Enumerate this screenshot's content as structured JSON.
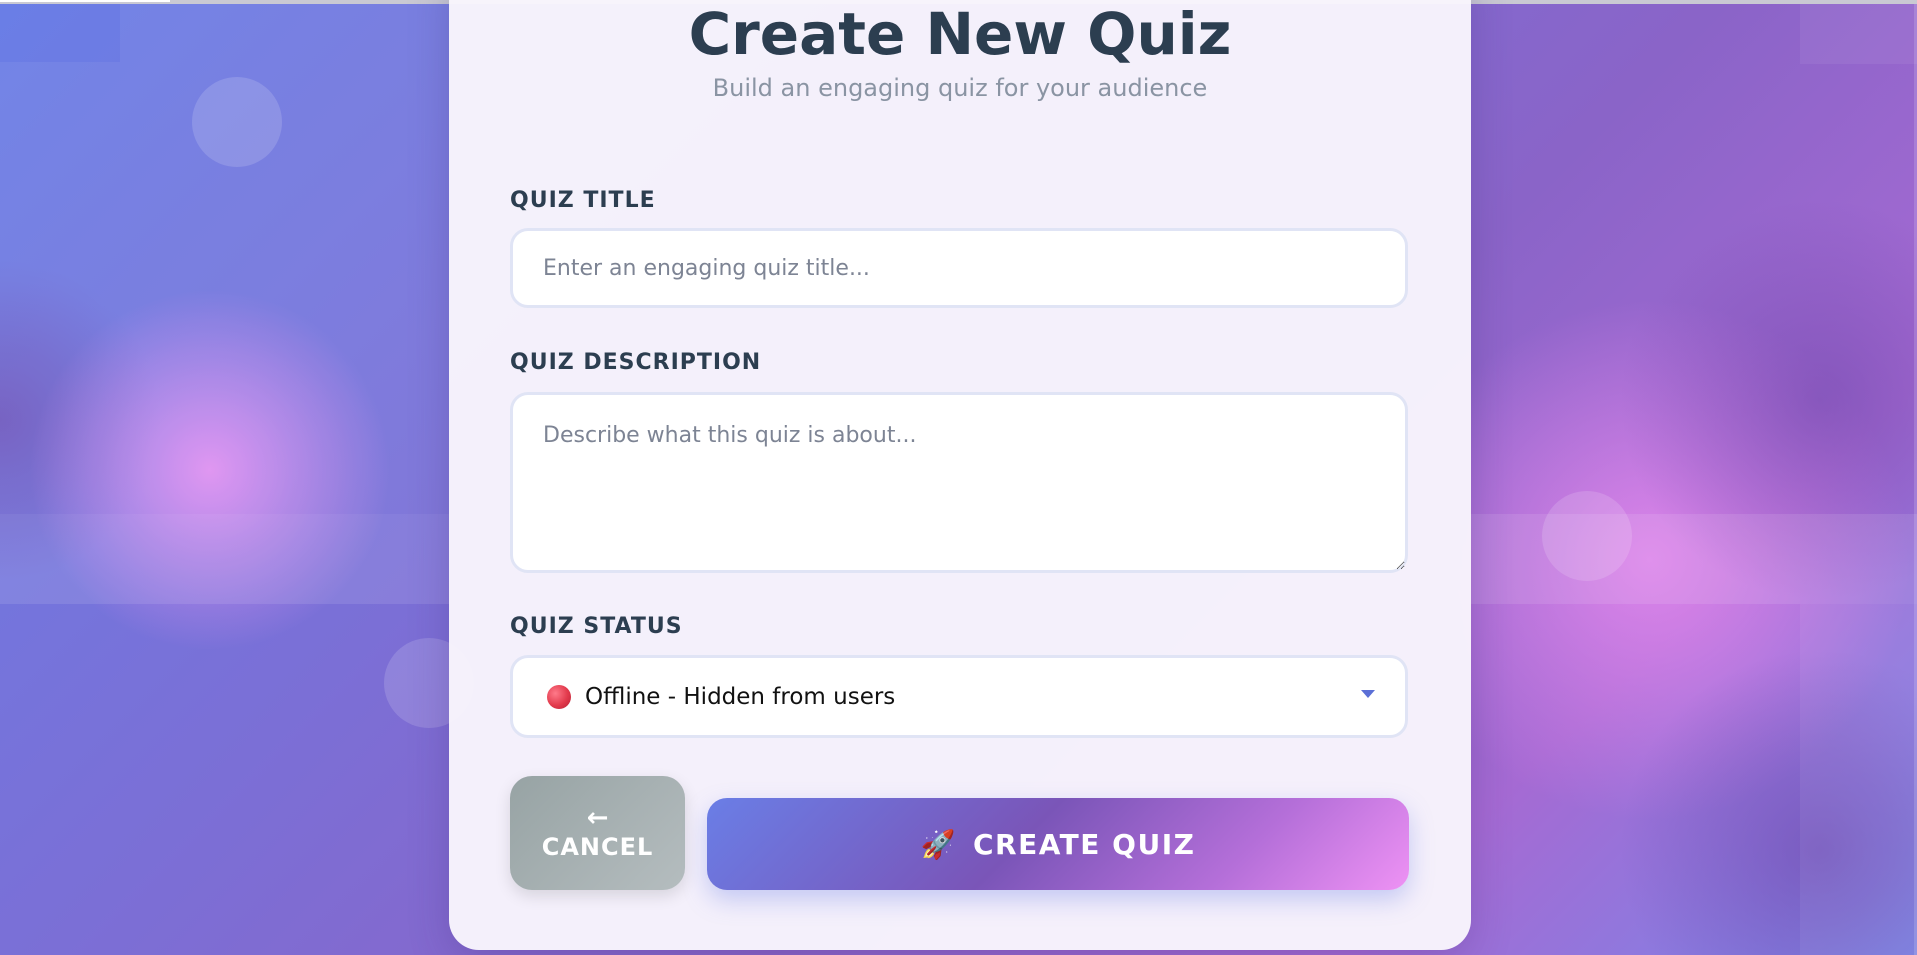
{
  "form": {
    "title": "Create New Quiz",
    "subtitle": "Build an engaging quiz for your audience",
    "quiz_title": {
      "label": "QUIZ TITLE",
      "placeholder": "Enter an engaging quiz title...",
      "value": ""
    },
    "quiz_description": {
      "label": "QUIZ DESCRIPTION",
      "placeholder": "Describe what this quiz is about...",
      "value": ""
    },
    "quiz_status": {
      "label": "QUIZ STATUS",
      "selected": "Offline - Hidden from users",
      "indicator_color": "#e23a4c"
    },
    "buttons": {
      "cancel_arrow": "←",
      "cancel_label": "CANCEL",
      "create_icon": "🚀",
      "create_label": "CREATE QUIZ"
    }
  },
  "colors": {
    "heading": "#2c3e50",
    "accent": "#6a7ee6",
    "accent_end": "#ee92f4",
    "field_border": "#e0e4f5"
  }
}
